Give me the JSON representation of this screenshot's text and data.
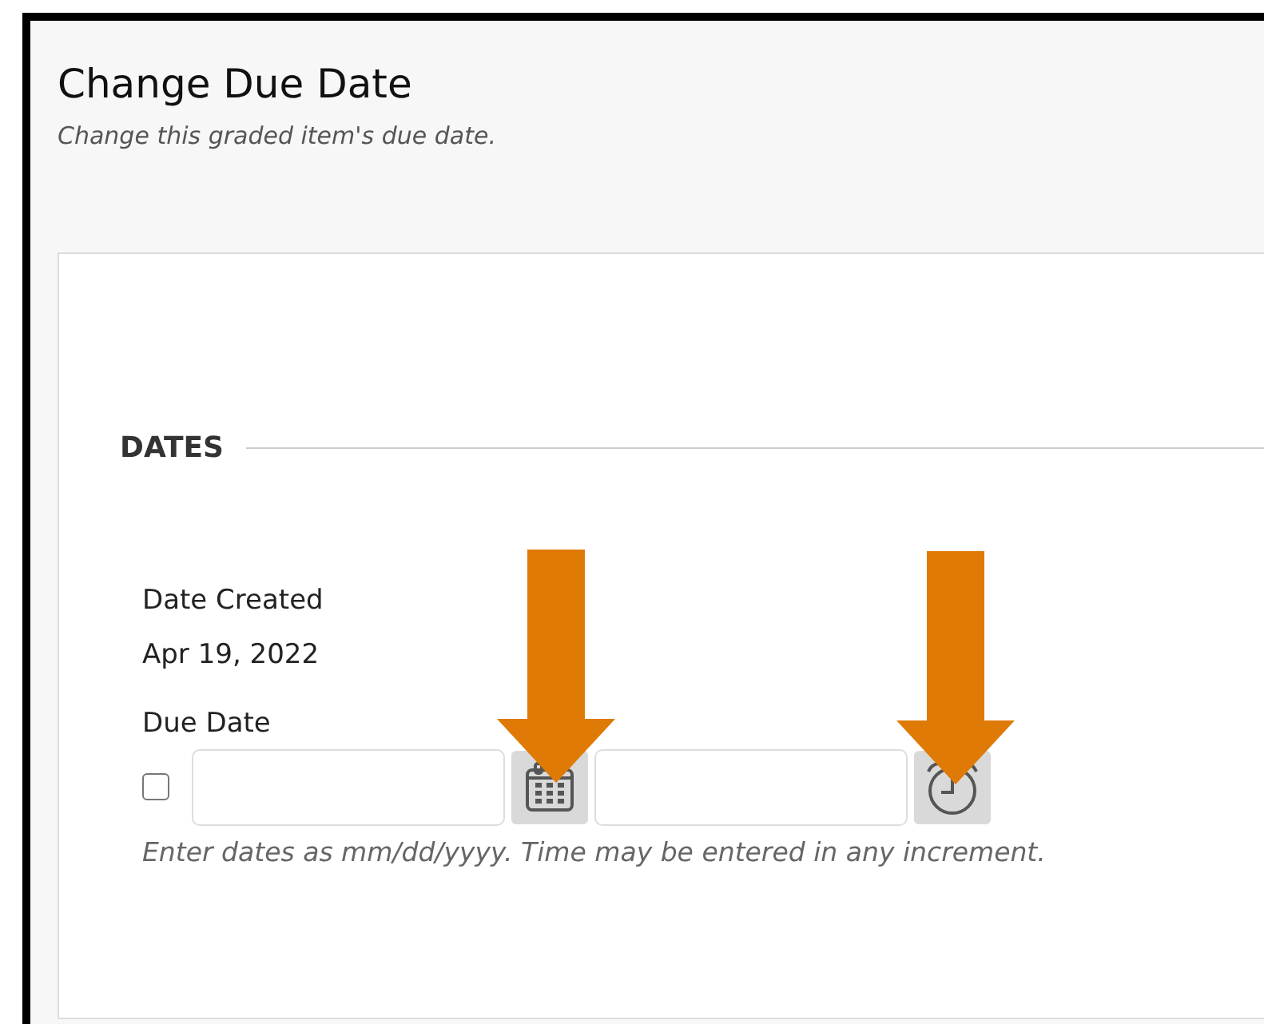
{
  "page": {
    "title": "Change Due Date",
    "subtitle": "Change this graded item's due date."
  },
  "section": {
    "heading": "DATES"
  },
  "date_created": {
    "label": "Date Created",
    "value": "Apr 19, 2022"
  },
  "due_date": {
    "label": "Due Date",
    "checked": false,
    "hint": "Enter dates as mm/dd/yyyy. Time may be entered in any increment."
  }
}
